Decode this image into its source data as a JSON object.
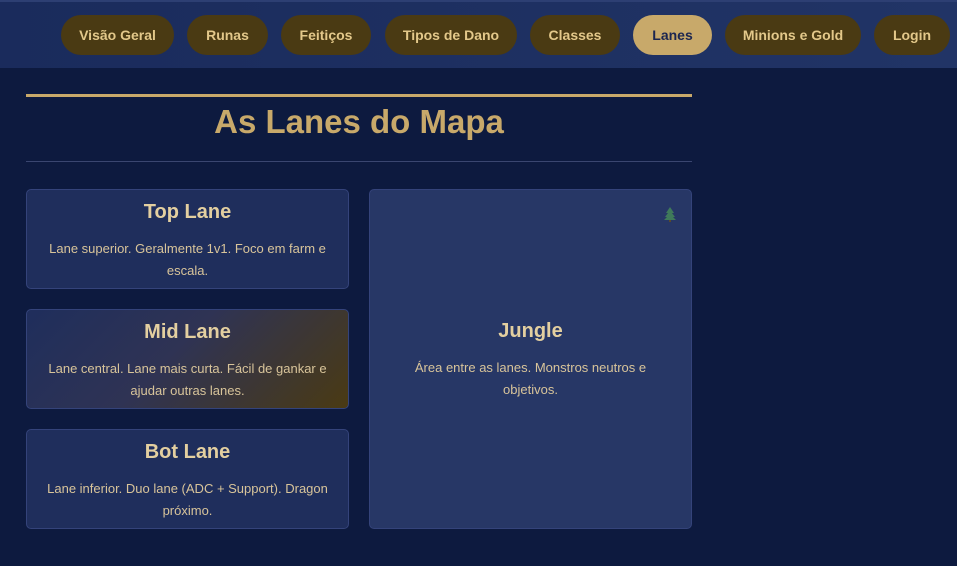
{
  "nav": {
    "items": [
      {
        "label": "Visão Geral"
      },
      {
        "label": "Runas"
      },
      {
        "label": "Feitiços"
      },
      {
        "label": "Tipos de Dano"
      },
      {
        "label": "Classes"
      },
      {
        "label": "Lanes",
        "active": true
      },
      {
        "label": "Minions e Gold"
      },
      {
        "label": "Login"
      }
    ]
  },
  "page": {
    "title": "As Lanes do Mapa"
  },
  "lanes": [
    {
      "title": "Top Lane",
      "description": "Lane superior. Geralmente 1v1. Foco em farm e escala."
    },
    {
      "title": "Mid Lane",
      "description": "Lane central. Lane mais curta. Fácil de gankar e ajudar outras lanes."
    },
    {
      "title": "Bot Lane",
      "description": "Lane inferior. Duo lane (ADC + Support). Dragon próximo."
    }
  ],
  "jungle": {
    "title": "Jungle",
    "description": "Área entre as lanes. Monstros neutros e objetivos.",
    "icon": "tree-icon"
  },
  "colors": {
    "gold": "#c8a96a",
    "nav_pill": "#4a3a13",
    "background": "#0d1a3f"
  }
}
